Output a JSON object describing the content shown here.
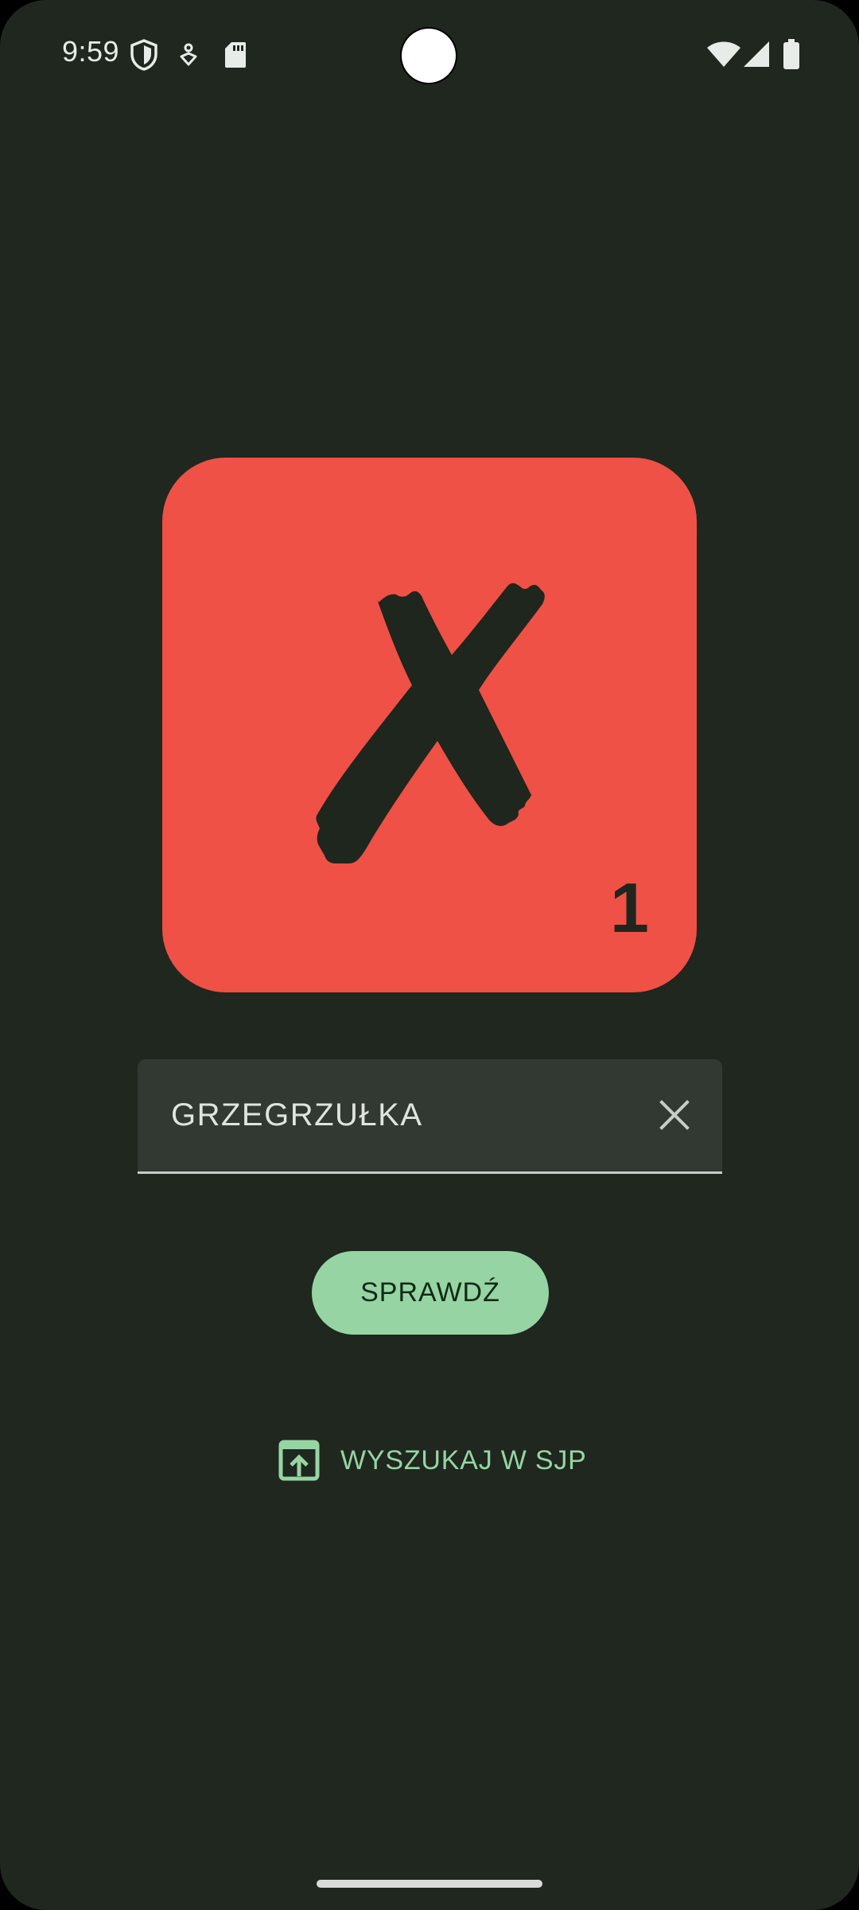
{
  "status_bar": {
    "time": "9:59",
    "left_icons": [
      "shield-icon",
      "accessibility-icon",
      "sd-card-icon"
    ],
    "right_icons": [
      "wifi-icon",
      "cellular-signal-icon",
      "battery-icon"
    ]
  },
  "tile": {
    "letter": "X",
    "score": "1",
    "colors": {
      "tile_background": "#ef5146",
      "letter": "#1e261e"
    }
  },
  "word_field": {
    "value": "GRZEGRZUŁKA",
    "clear_icon": "close-icon"
  },
  "actions": {
    "check_label": "SPRAWDŹ",
    "sjp_label": "WYSZUKAJ W SJP",
    "sjp_icon": "open-in-browser-icon"
  },
  "theme": {
    "background": "#1f271f",
    "accent": "#96d5a3",
    "field_background": "#323832"
  }
}
